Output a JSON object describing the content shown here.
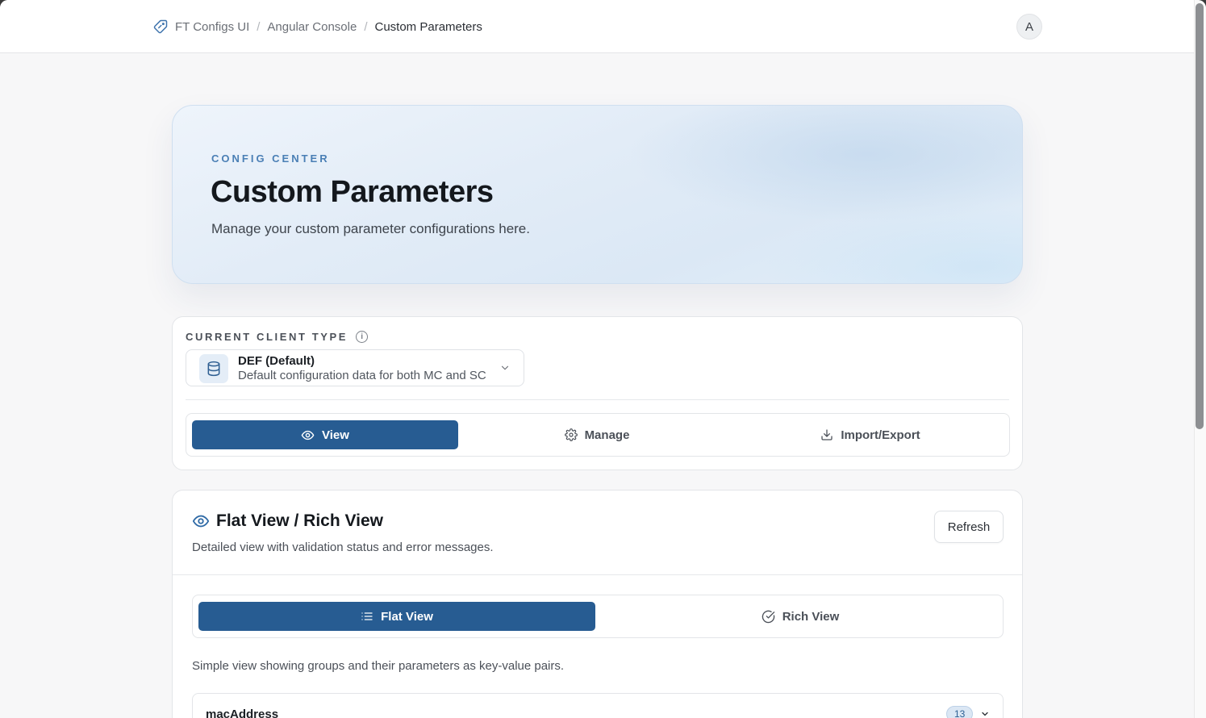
{
  "breadcrumb": {
    "items": [
      "FT Configs UI",
      "Angular Console"
    ],
    "current": "Custom Parameters"
  },
  "user": {
    "avatar_initial": "A"
  },
  "hero": {
    "eyebrow": "CONFIG CENTER",
    "title": "Custom Parameters",
    "subtitle": "Manage your custom parameter configurations here."
  },
  "client_type": {
    "label": "CURRENT CLIENT TYPE",
    "selected_name": "DEF (Default)",
    "selected_description": "Default configuration data for both MC and SC"
  },
  "mode_tabs": [
    {
      "label": "View",
      "icon": "eye-icon",
      "active": true
    },
    {
      "label": "Manage",
      "icon": "gear-icon",
      "active": false
    },
    {
      "label": "Import/Export",
      "icon": "download-icon",
      "active": false
    }
  ],
  "flat_section": {
    "title": "Flat View / Rich View",
    "description": "Detailed view with validation status and error messages.",
    "refresh_label": "Refresh",
    "view_tabs": [
      {
        "label": "Flat View",
        "icon": "list-icon",
        "active": true
      },
      {
        "label": "Rich View",
        "icon": "check-circle-icon",
        "active": false
      }
    ],
    "hint": "Simple view showing groups and their parameters as key-value pairs.",
    "groups": [
      {
        "name": "macAddress",
        "count": "13"
      }
    ]
  },
  "colors": {
    "accent": "#275c92",
    "eyebrow": "#4a7fb5",
    "page_bg": "#f7f7f8"
  }
}
